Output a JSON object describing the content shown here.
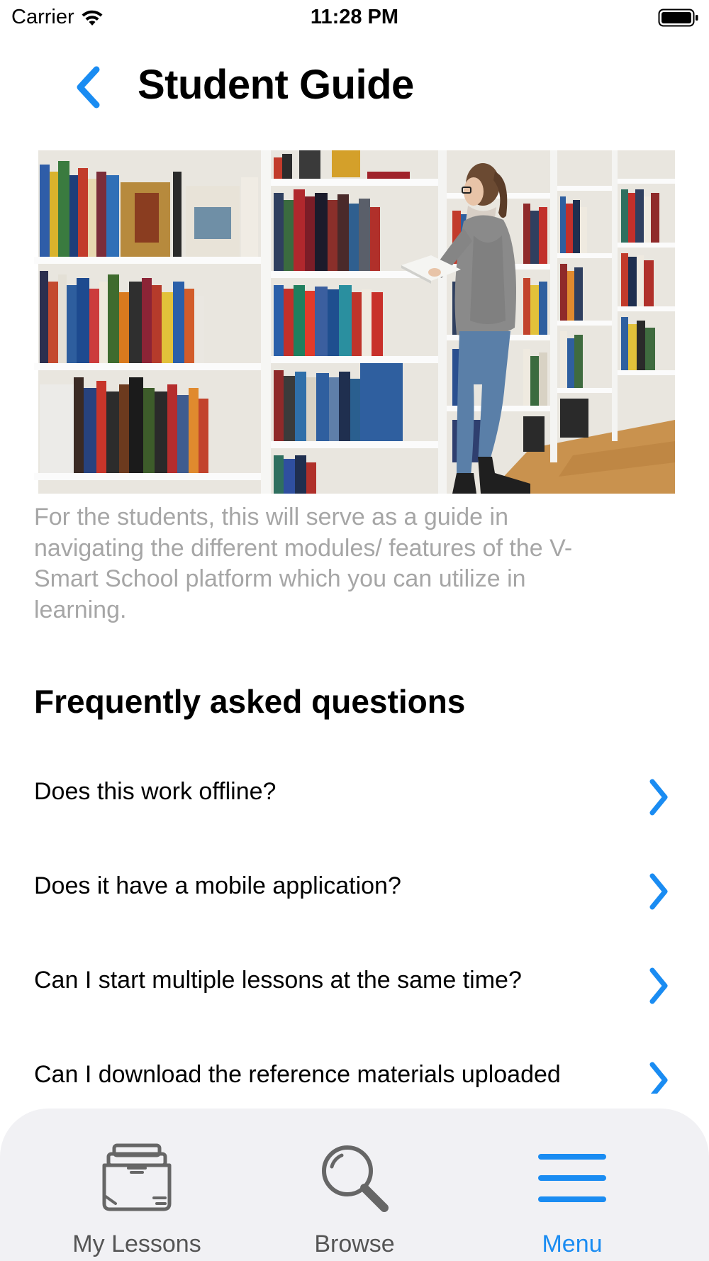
{
  "status_bar": {
    "carrier": "Carrier",
    "time": "11:28 PM",
    "icons": [
      "wifi-icon",
      "battery-icon"
    ]
  },
  "header": {
    "back_icon": "chevron-left-icon",
    "title": "Student Guide"
  },
  "hero_image": {
    "subject": "student reading a book in a library between bookshelves"
  },
  "description": "For the students, this will serve as a guide in navigating the different modules/ features of the V-Smart School platform which you can utilize in learning.",
  "faq": {
    "heading": "Frequently asked questions",
    "items": [
      {
        "question": "Does this work offline?",
        "icon": "chevron-right-icon"
      },
      {
        "question": "Does it have a mobile application?",
        "icon": "chevron-right-icon"
      },
      {
        "question": "Can I start multiple lessons at the same time?",
        "icon": "chevron-right-icon"
      },
      {
        "question": "Can I download the reference materials uploaded",
        "icon": "chevron-right-icon"
      }
    ]
  },
  "tab_bar": {
    "tabs": [
      {
        "label": "My Lessons",
        "icon": "inbox-tray-icon",
        "active": false
      },
      {
        "label": "Browse",
        "icon": "search-icon",
        "active": false
      },
      {
        "label": "Menu",
        "icon": "hamburger-menu-icon",
        "active": true
      }
    ]
  },
  "colors": {
    "accent": "#1a8cf2",
    "description_text": "#a6a6a6",
    "tab_bar_bg": "#f1f1f4",
    "inactive_tab": "#555555"
  }
}
